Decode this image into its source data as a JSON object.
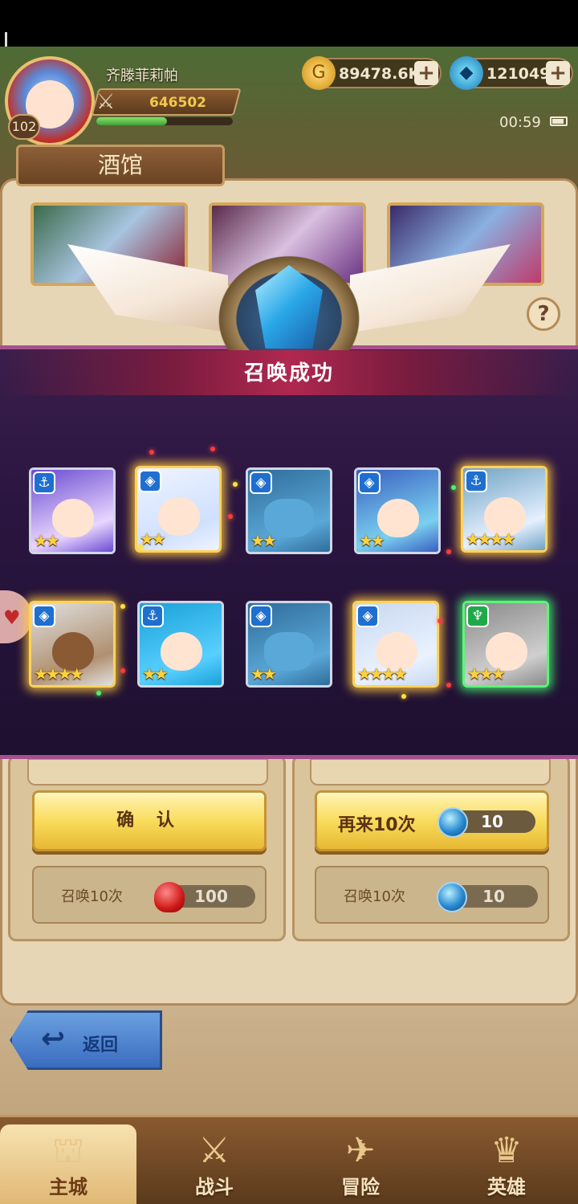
{
  "player": {
    "name": "齐滕菲莉帕",
    "level": "102",
    "power": "646502",
    "xp_progress": 0.52
  },
  "currency": {
    "gold": "89478.6K",
    "gems": "121049"
  },
  "status": {
    "time": "00:59"
  },
  "page": {
    "title": "酒馆"
  },
  "result": {
    "title": "召唤成功",
    "heroes": [
      {
        "stars": "★★",
        "class": "anchor",
        "glow": "none"
      },
      {
        "stars": "★★",
        "class": "shield",
        "glow": "gold"
      },
      {
        "stars": "★★",
        "class": "shield",
        "glow": "none"
      },
      {
        "stars": "★★",
        "class": "shield",
        "glow": "none"
      },
      {
        "stars": "★★★★",
        "class": "anchor",
        "glow": "gold"
      },
      {
        "stars": "★★★★",
        "class": "shield",
        "glow": "gold"
      },
      {
        "stars": "★★",
        "class": "anchor",
        "glow": "none"
      },
      {
        "stars": "★★",
        "class": "shield",
        "glow": "none"
      },
      {
        "stars": "★★★★",
        "class": "shield",
        "glow": "gold"
      },
      {
        "stars": "★★★",
        "class": "dragon",
        "glow": "green"
      }
    ]
  },
  "actions": {
    "confirm_label": "确 认",
    "again_label": "再来10次",
    "again_cost": "10",
    "summon_left_label": "召唤10次",
    "summon_left_cost": "100",
    "summon_right_label": "召唤10次",
    "summon_right_cost": "10",
    "back_label": "返回"
  },
  "nav": {
    "home": "主城",
    "battle": "战斗",
    "adventure": "冒险",
    "heroes": "英雄"
  },
  "icons": {
    "help": "?",
    "plus": "+",
    "anchor": "⚓",
    "shield": "◈",
    "dragon": "♆"
  }
}
